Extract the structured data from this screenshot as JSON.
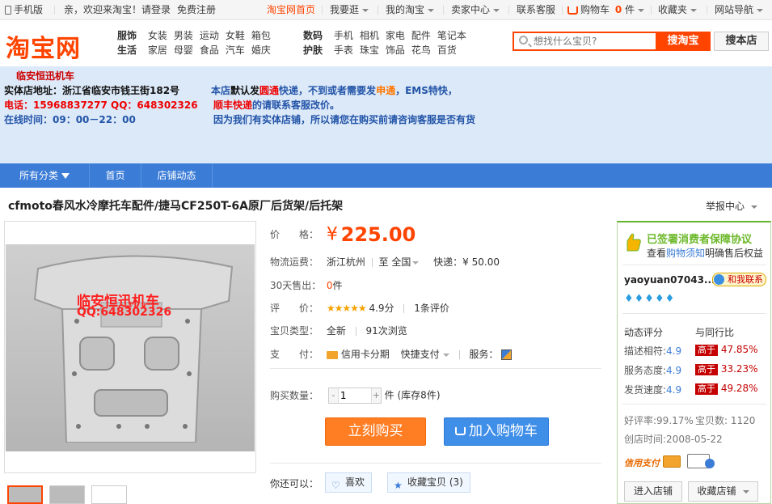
{
  "topnav": {
    "mobile": "手机版",
    "welcome": "亲，欢迎来淘宝！请",
    "login": "登录",
    "register": "免费注册",
    "home": "淘宝网首页",
    "browse": "我要逛",
    "my_taobao": "我的淘宝",
    "seller_center": "卖家中心",
    "contact": "联系客服",
    "cart": "购物车",
    "cart_count": "0",
    "cart_unit": "件",
    "favorites": "收藏夹",
    "site_nav": "网站导航"
  },
  "header": {
    "logo": "淘宝网",
    "categories": [
      {
        "label": "服饰",
        "items": [
          "女装",
          "男装",
          "运动",
          "女鞋",
          "箱包"
        ]
      },
      {
        "label": "生活",
        "items": [
          "家居",
          "母婴",
          "食品",
          "汽车",
          "婚庆"
        ]
      },
      {
        "label": "数码",
        "items": [
          "手机",
          "相机",
          "家电",
          "配件",
          "笔记本"
        ]
      },
      {
        "label": "护肤",
        "items": [
          "手表",
          "珠宝",
          "饰品",
          "花鸟",
          "百货"
        ]
      }
    ],
    "search_placeholder": "想找什么宝贝?",
    "search_taobao": "搜淘宝",
    "search_store": "搜本店"
  },
  "banner": {
    "shop_name": "临安恒迅机车",
    "address": "实体店地址：浙江省临安市钱王街182号",
    "phone": "电话：15968837277 QQ：648302326",
    "hours": "在线时间：09：00－22：00",
    "notice1_a": "本店",
    "notice1_b": "默认发",
    "notice1_c": "圆通",
    "notice1_d": "快递，不到或者需要发",
    "notice1_e": "申通",
    "notice1_f": "，EMS特快，",
    "notice2_a": "顺丰快递",
    "notice2_b": "的请联系客服改价。",
    "notice3": "因为我们有实体店铺，所以请您在购买前请咨询客服是否有货"
  },
  "shopnav": {
    "all_categories": "所有分类",
    "home": "首页",
    "news": "店铺动态"
  },
  "product": {
    "title": "cfmoto春风水冷摩托车配件/捷马CF250T-6A原厂后货架/后托架",
    "report": "举报中心",
    "watermark_name": "临安恒迅机车",
    "watermark_qq": "QQ:648302326",
    "price_label": "价　　格：",
    "price_symbol": "¥",
    "price": "225.00",
    "shipping_label": "物流运费：",
    "ship_from": "浙江杭州",
    "ship_to": "至 全国",
    "express": "快递：¥ 50.00",
    "sold_label": "30天售出：",
    "sold_count": "0",
    "sold_unit": "件",
    "rating_label": "评　　价：",
    "stars": "★★★★★",
    "score": "4.9分",
    "reviews": "1条评价",
    "type_label": "宝贝类型：",
    "condition": "全新",
    "views": "91次浏览",
    "pay_label": "支　　付：",
    "credit": "信用卡分期",
    "quick_pay": "快捷支付",
    "service_label": "服务：",
    "qty_label": "购买数量：",
    "qty_value": "1",
    "qty_unit": "件",
    "stock": "(库存8件)",
    "buy_now": "立刻购买",
    "add_cart": "加入购物车",
    "you_can": "你还可以：",
    "like": "喜欢",
    "collect": "收藏宝贝 (3)"
  },
  "seller": {
    "guarantee": "已签署消费者保障协议",
    "guarantee_sub_a": "查看",
    "guarantee_sub_b": "购物须知",
    "guarantee_sub_c": "明确售后权益",
    "name": "yaoyuan07043...",
    "talk": "和我联系",
    "gems": "♦♦♦♦♦",
    "dyn_label": "动态评分",
    "compare_label": "与同行比",
    "ratings": [
      {
        "label": "描述相符:",
        "score": "4.9",
        "badge": "高于",
        "pct": "47.85%"
      },
      {
        "label": "服务态度:",
        "score": "4.9",
        "badge": "高于",
        "pct": "33.23%"
      },
      {
        "label": "发货速度:",
        "score": "4.9",
        "badge": "高于",
        "pct": "49.28%"
      }
    ],
    "good_rate": "好评率:99.17%",
    "item_count": "宝贝数: 1120",
    "created": "创店时间:2008-05-22",
    "credit_pay": "信用支付",
    "enter_store": "进入店铺",
    "fav_store": "收藏店铺"
  }
}
